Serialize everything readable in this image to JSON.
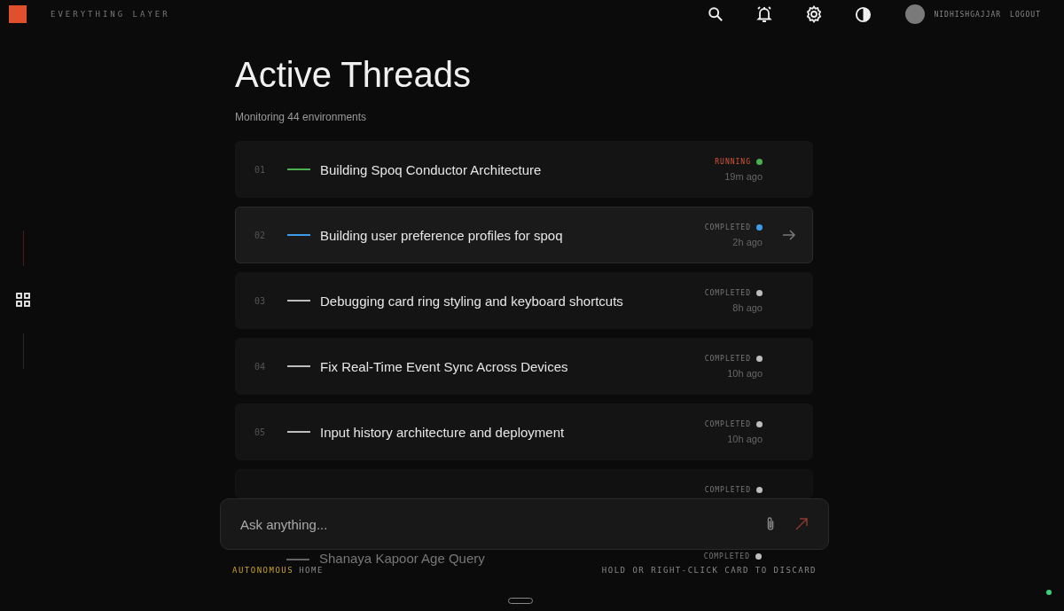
{
  "brand": {
    "name": "EVERYTHING LAYER"
  },
  "header": {
    "user": "NIDHISHGAJJAR",
    "logout": "LOGOUT"
  },
  "page": {
    "title": "Active Threads",
    "subtitle": "Monitoring 44 environments"
  },
  "threads": [
    {
      "number": "01",
      "title": "Building Spoq Conductor Architecture",
      "status": "RUNNING",
      "kind": "running",
      "color": "#4caf50",
      "time": "19m ago",
      "selected": false
    },
    {
      "number": "02",
      "title": "Building user preference profiles for spoq",
      "status": "COMPLETED",
      "kind": "completed",
      "color": "#3d9be9",
      "time": "2h ago",
      "selected": true
    },
    {
      "number": "03",
      "title": "Debugging card ring styling and keyboard shortcuts",
      "status": "COMPLETED",
      "kind": "completed",
      "color": "#bdbdbd",
      "time": "8h ago",
      "selected": false
    },
    {
      "number": "04",
      "title": "Fix Real-Time Event Sync Across Devices",
      "status": "COMPLETED",
      "kind": "completed",
      "color": "#bdbdbd",
      "time": "10h ago",
      "selected": false
    },
    {
      "number": "05",
      "title": "Input history architecture and deployment",
      "status": "COMPLETED",
      "kind": "completed",
      "color": "#bdbdbd",
      "time": "10h ago",
      "selected": false
    }
  ],
  "threads_under_composer": [
    {
      "status": "COMPLETED",
      "kind": "completed",
      "color": "#bdbdbd",
      "selected": false
    },
    {
      "title": "Shanaya Kapoor Age Query",
      "status": "COMPLETED",
      "kind": "completed",
      "color": "#bdbdbd",
      "selected": false
    }
  ],
  "composer": {
    "placeholder": "Ask anything..."
  },
  "footer": {
    "mode": "AUTONOMOUS",
    "location": "HOME",
    "hint": "HOLD OR RIGHT-CLICK CARD TO DISCARD"
  }
}
